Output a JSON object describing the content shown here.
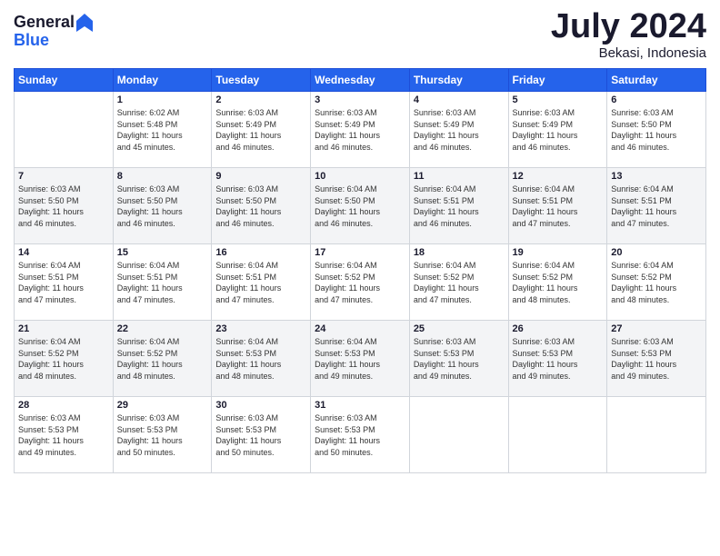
{
  "header": {
    "logo_line1": "General",
    "logo_line2": "Blue",
    "month_year": "July 2024",
    "location": "Bekasi, Indonesia"
  },
  "days_of_week": [
    "Sunday",
    "Monday",
    "Tuesday",
    "Wednesday",
    "Thursday",
    "Friday",
    "Saturday"
  ],
  "weeks": [
    [
      {
        "day": "",
        "sunrise": "",
        "sunset": "",
        "daylight": ""
      },
      {
        "day": "1",
        "sunrise": "Sunrise: 6:02 AM",
        "sunset": "Sunset: 5:48 PM",
        "daylight": "Daylight: 11 hours and 45 minutes."
      },
      {
        "day": "2",
        "sunrise": "Sunrise: 6:03 AM",
        "sunset": "Sunset: 5:49 PM",
        "daylight": "Daylight: 11 hours and 46 minutes."
      },
      {
        "day": "3",
        "sunrise": "Sunrise: 6:03 AM",
        "sunset": "Sunset: 5:49 PM",
        "daylight": "Daylight: 11 hours and 46 minutes."
      },
      {
        "day": "4",
        "sunrise": "Sunrise: 6:03 AM",
        "sunset": "Sunset: 5:49 PM",
        "daylight": "Daylight: 11 hours and 46 minutes."
      },
      {
        "day": "5",
        "sunrise": "Sunrise: 6:03 AM",
        "sunset": "Sunset: 5:49 PM",
        "daylight": "Daylight: 11 hours and 46 minutes."
      },
      {
        "day": "6",
        "sunrise": "Sunrise: 6:03 AM",
        "sunset": "Sunset: 5:50 PM",
        "daylight": "Daylight: 11 hours and 46 minutes."
      }
    ],
    [
      {
        "day": "7",
        "sunrise": "Sunrise: 6:03 AM",
        "sunset": "Sunset: 5:50 PM",
        "daylight": "Daylight: 11 hours and 46 minutes."
      },
      {
        "day": "8",
        "sunrise": "Sunrise: 6:03 AM",
        "sunset": "Sunset: 5:50 PM",
        "daylight": "Daylight: 11 hours and 46 minutes."
      },
      {
        "day": "9",
        "sunrise": "Sunrise: 6:03 AM",
        "sunset": "Sunset: 5:50 PM",
        "daylight": "Daylight: 11 hours and 46 minutes."
      },
      {
        "day": "10",
        "sunrise": "Sunrise: 6:04 AM",
        "sunset": "Sunset: 5:50 PM",
        "daylight": "Daylight: 11 hours and 46 minutes."
      },
      {
        "day": "11",
        "sunrise": "Sunrise: 6:04 AM",
        "sunset": "Sunset: 5:51 PM",
        "daylight": "Daylight: 11 hours and 46 minutes."
      },
      {
        "day": "12",
        "sunrise": "Sunrise: 6:04 AM",
        "sunset": "Sunset: 5:51 PM",
        "daylight": "Daylight: 11 hours and 47 minutes."
      },
      {
        "day": "13",
        "sunrise": "Sunrise: 6:04 AM",
        "sunset": "Sunset: 5:51 PM",
        "daylight": "Daylight: 11 hours and 47 minutes."
      }
    ],
    [
      {
        "day": "14",
        "sunrise": "Sunrise: 6:04 AM",
        "sunset": "Sunset: 5:51 PM",
        "daylight": "Daylight: 11 hours and 47 minutes."
      },
      {
        "day": "15",
        "sunrise": "Sunrise: 6:04 AM",
        "sunset": "Sunset: 5:51 PM",
        "daylight": "Daylight: 11 hours and 47 minutes."
      },
      {
        "day": "16",
        "sunrise": "Sunrise: 6:04 AM",
        "sunset": "Sunset: 5:51 PM",
        "daylight": "Daylight: 11 hours and 47 minutes."
      },
      {
        "day": "17",
        "sunrise": "Sunrise: 6:04 AM",
        "sunset": "Sunset: 5:52 PM",
        "daylight": "Daylight: 11 hours and 47 minutes."
      },
      {
        "day": "18",
        "sunrise": "Sunrise: 6:04 AM",
        "sunset": "Sunset: 5:52 PM",
        "daylight": "Daylight: 11 hours and 47 minutes."
      },
      {
        "day": "19",
        "sunrise": "Sunrise: 6:04 AM",
        "sunset": "Sunset: 5:52 PM",
        "daylight": "Daylight: 11 hours and 48 minutes."
      },
      {
        "day": "20",
        "sunrise": "Sunrise: 6:04 AM",
        "sunset": "Sunset: 5:52 PM",
        "daylight": "Daylight: 11 hours and 48 minutes."
      }
    ],
    [
      {
        "day": "21",
        "sunrise": "Sunrise: 6:04 AM",
        "sunset": "Sunset: 5:52 PM",
        "daylight": "Daylight: 11 hours and 48 minutes."
      },
      {
        "day": "22",
        "sunrise": "Sunrise: 6:04 AM",
        "sunset": "Sunset: 5:52 PM",
        "daylight": "Daylight: 11 hours and 48 minutes."
      },
      {
        "day": "23",
        "sunrise": "Sunrise: 6:04 AM",
        "sunset": "Sunset: 5:53 PM",
        "daylight": "Daylight: 11 hours and 48 minutes."
      },
      {
        "day": "24",
        "sunrise": "Sunrise: 6:04 AM",
        "sunset": "Sunset: 5:53 PM",
        "daylight": "Daylight: 11 hours and 49 minutes."
      },
      {
        "day": "25",
        "sunrise": "Sunrise: 6:03 AM",
        "sunset": "Sunset: 5:53 PM",
        "daylight": "Daylight: 11 hours and 49 minutes."
      },
      {
        "day": "26",
        "sunrise": "Sunrise: 6:03 AM",
        "sunset": "Sunset: 5:53 PM",
        "daylight": "Daylight: 11 hours and 49 minutes."
      },
      {
        "day": "27",
        "sunrise": "Sunrise: 6:03 AM",
        "sunset": "Sunset: 5:53 PM",
        "daylight": "Daylight: 11 hours and 49 minutes."
      }
    ],
    [
      {
        "day": "28",
        "sunrise": "Sunrise: 6:03 AM",
        "sunset": "Sunset: 5:53 PM",
        "daylight": "Daylight: 11 hours and 49 minutes."
      },
      {
        "day": "29",
        "sunrise": "Sunrise: 6:03 AM",
        "sunset": "Sunset: 5:53 PM",
        "daylight": "Daylight: 11 hours and 50 minutes."
      },
      {
        "day": "30",
        "sunrise": "Sunrise: 6:03 AM",
        "sunset": "Sunset: 5:53 PM",
        "daylight": "Daylight: 11 hours and 50 minutes."
      },
      {
        "day": "31",
        "sunrise": "Sunrise: 6:03 AM",
        "sunset": "Sunset: 5:53 PM",
        "daylight": "Daylight: 11 hours and 50 minutes."
      },
      {
        "day": "",
        "sunrise": "",
        "sunset": "",
        "daylight": ""
      },
      {
        "day": "",
        "sunrise": "",
        "sunset": "",
        "daylight": ""
      },
      {
        "day": "",
        "sunrise": "",
        "sunset": "",
        "daylight": ""
      }
    ]
  ]
}
